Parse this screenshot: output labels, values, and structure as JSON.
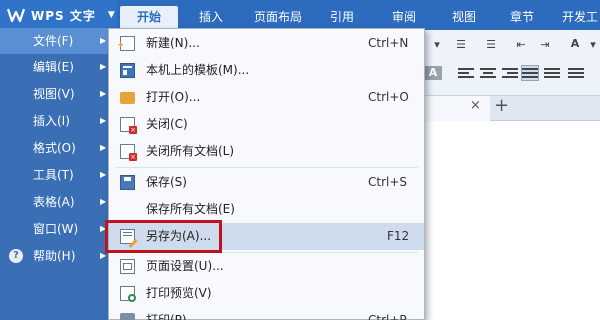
{
  "app": {
    "title": "WPS 文字"
  },
  "ribbon_tabs": [
    {
      "label": "开始",
      "active": true
    },
    {
      "label": "插入"
    },
    {
      "label": "页面布局"
    },
    {
      "label": "引用"
    },
    {
      "label": "审阅"
    },
    {
      "label": "视图"
    },
    {
      "label": "章节"
    },
    {
      "label": "开发工"
    }
  ],
  "main_menu": [
    {
      "label": "文件(F)",
      "active": true
    },
    {
      "label": "编辑(E)"
    },
    {
      "label": "视图(V)"
    },
    {
      "label": "插入(I)"
    },
    {
      "label": "格式(O)"
    },
    {
      "label": "工具(T)"
    },
    {
      "label": "表格(A)"
    },
    {
      "label": "窗口(W)"
    },
    {
      "label": "帮助(H)",
      "icon": "help-icon"
    }
  ],
  "file_menu": [
    {
      "label": "新建(N)...",
      "shortcut": "Ctrl+N",
      "icon": "new-document-icon"
    },
    {
      "label": "本机上的模板(M)...",
      "shortcut": "",
      "icon": "template-icon"
    },
    {
      "label": "打开(O)...",
      "shortcut": "Ctrl+O",
      "icon": "open-folder-icon"
    },
    {
      "label": "关闭(C)",
      "shortcut": "",
      "icon": "close-document-icon"
    },
    {
      "label": "关闭所有文档(L)",
      "shortcut": "",
      "icon": "close-all-icon"
    },
    {
      "label": "保存(S)",
      "shortcut": "Ctrl+S",
      "icon": "save-icon"
    },
    {
      "label": "保存所有文档(E)",
      "shortcut": "",
      "icon": ""
    },
    {
      "label": "另存为(A)...",
      "shortcut": "F12",
      "icon": "save-as-icon",
      "highlighted": true
    },
    {
      "label": "页面设置(U)...",
      "shortcut": "",
      "icon": "page-setup-icon"
    },
    {
      "label": "打印预览(V)",
      "shortcut": "",
      "icon": "print-preview-icon"
    },
    {
      "label": "打印(P)...",
      "shortcut": "Ctrl+P",
      "icon": "print-icon"
    }
  ],
  "doc_tabs": {
    "close_glyph": "×",
    "new_tab_glyph": "+"
  },
  "colors": {
    "ribbon_blue": "#2c6bbd",
    "menu_blue": "#3a6fb5",
    "menu_highlight": "#cfdcee",
    "annotation_red": "#c1121f"
  }
}
